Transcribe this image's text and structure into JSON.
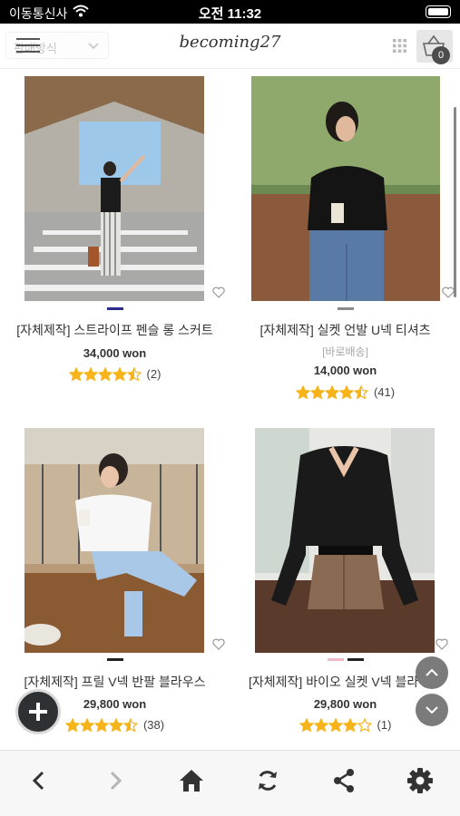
{
  "status_bar": {
    "carrier": "이동통신사",
    "time": "오전 11:32"
  },
  "header": {
    "sort_label": "판매방식",
    "brand": "becoming27",
    "cart_count": "0"
  },
  "products": [
    {
      "name": "[자체제작] 스트라이프 펜슬 롱 스커트",
      "subtitle": "",
      "price": "34,000 won",
      "rating": 4.5,
      "reviews": "(2)",
      "slides": 1,
      "active_slide": 0
    },
    {
      "name": "[자체제작] 실켓 언발 U넥 티셔츠",
      "subtitle": "[바로배송]",
      "price": "14,000 won",
      "rating": 4.5,
      "reviews": "(41)",
      "slides": 1,
      "active_slide": 0
    },
    {
      "name": "[자체제작] 프릴 V넥 반팔 블라우스",
      "subtitle": "",
      "price": "29,800 won",
      "rating": 4.5,
      "reviews": "(38)",
      "slides": 1,
      "active_slide": 0
    },
    {
      "name": "[자체제작] 바이오 실켓 V넥 블라우스",
      "subtitle": "",
      "price": "29,800 won",
      "rating": 4,
      "reviews": "(1)",
      "slides": 2,
      "active_slide": 1
    }
  ],
  "colors": {
    "star": "#f6b41a",
    "active_dot_1": "#2a2a8c",
    "active_dot_dark": "#222222",
    "inactive_dot_pink": "#f2b8c6"
  },
  "icons": {
    "status": [
      "wifi-icon",
      "battery-icon"
    ],
    "header": [
      "menu-icon",
      "chevron-down-icon",
      "grid-icon",
      "cart-icon"
    ],
    "card": [
      "heart-icon",
      "star-icon"
    ],
    "floating": [
      "plus-icon",
      "chevron-up-icon",
      "chevron-down-icon"
    ],
    "bottom_bar": [
      "back-arrow-icon",
      "forward-arrow-icon",
      "home-icon",
      "refresh-icon",
      "share-icon",
      "gear-icon"
    ]
  }
}
